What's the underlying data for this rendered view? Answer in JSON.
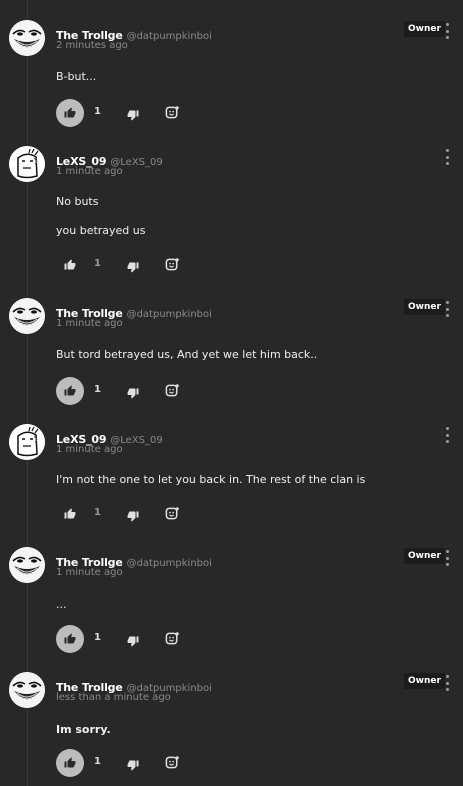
{
  "comments": [
    {
      "author": "The Trollge",
      "handle": "@datpumpkinboi",
      "time": "2 minutes ago",
      "badge": "Owner",
      "lines": [
        "B-but..."
      ],
      "likes": "1"
    },
    {
      "author": "LeXS_09",
      "handle": "@LeXS_09",
      "time": "1 minute ago",
      "badge": "",
      "lines": [
        "No buts",
        "you betrayed us"
      ],
      "likes": "1"
    },
    {
      "author": "The Trollge",
      "handle": "@datpumpkinboi",
      "time": "1 minute ago",
      "badge": "Owner",
      "lines": [
        "But tord betrayed us, And yet we let him back.."
      ],
      "likes": "1"
    },
    {
      "author": "LeXS_09",
      "handle": "@LeXS_09",
      "time": "1 minute ago",
      "badge": "",
      "lines": [
        "I'm not the one to let you back in. The rest of the clan is"
      ],
      "likes": "1"
    },
    {
      "author": "The Trollge",
      "handle": "@datpumpkinboi",
      "time": "1 minute ago",
      "badge": "Owner",
      "lines": [
        "..."
      ],
      "likes": "1"
    },
    {
      "author": "The Trollge",
      "handle": "@datpumpkinboi",
      "time": "less than a minute ago",
      "badge": "Owner",
      "lines": [
        "Im sorry."
      ],
      "likes": "1"
    }
  ],
  "icons": {
    "like": "thumbs-up-icon",
    "dislike": "thumbs-down-icon",
    "reaction": "add-reaction-icon",
    "more": "more-vertical-icon",
    "avatar_trollge": "trollface-avatar",
    "avatar_lexs": "doodle-avatar"
  },
  "colors": {
    "background": "#282828",
    "like_active": "#bcbcbc",
    "badge_bg": "#1c1c1c"
  }
}
